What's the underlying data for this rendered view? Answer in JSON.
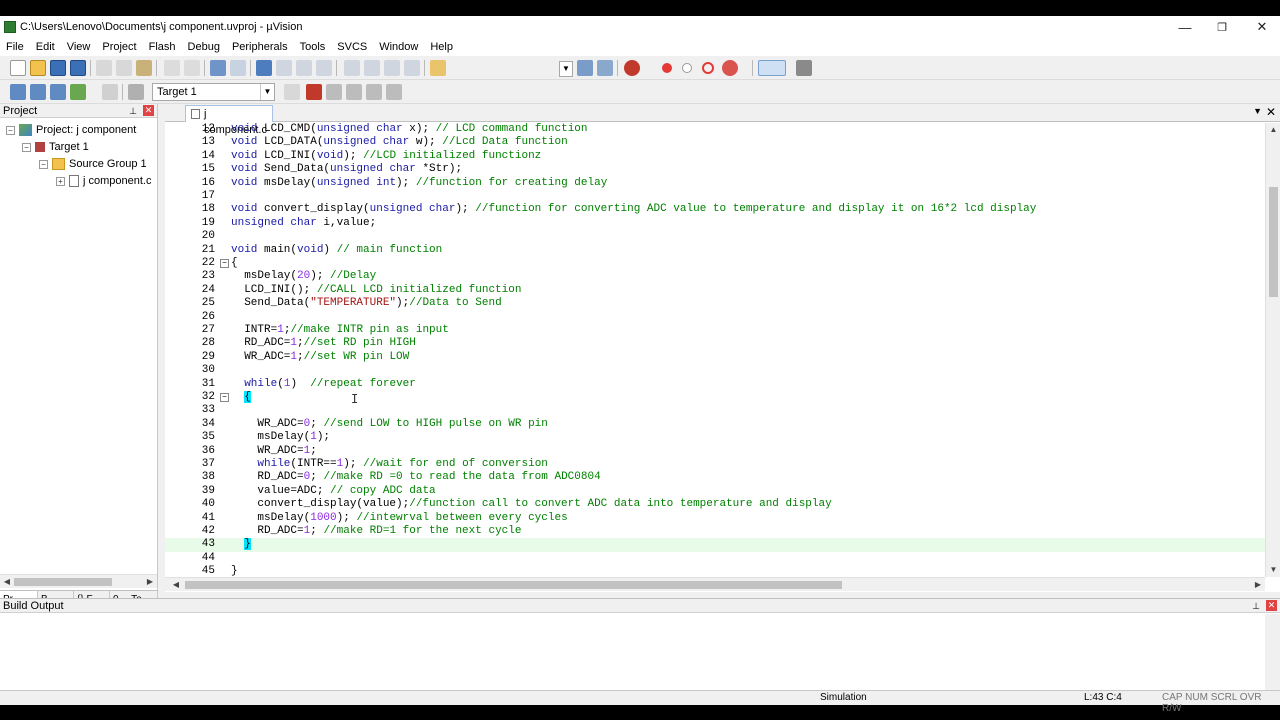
{
  "window": {
    "title": "C:\\Users\\Lenovo\\Documents\\j component.uvproj - µVision",
    "controls": [
      "—",
      "❐",
      "✕"
    ]
  },
  "menu": [
    "File",
    "Edit",
    "View",
    "Project",
    "Flash",
    "Debug",
    "Peripherals",
    "Tools",
    "SVCS",
    "Window",
    "Help"
  ],
  "toolbar2": {
    "target": "Target 1"
  },
  "project_panel": {
    "title": "Project",
    "tree": [
      {
        "label": "Project: j component",
        "indent": 0
      },
      {
        "label": "Target 1",
        "indent": 1
      },
      {
        "label": "Source Group 1",
        "indent": 2
      },
      {
        "label": "j component.c",
        "indent": 3
      }
    ],
    "tabs": [
      "Pr...",
      "B...",
      "{} F...",
      "0→ Te..."
    ]
  },
  "editor": {
    "tab": "j component.c",
    "lines": [
      {
        "n": "12",
        "html": "<span class=\"kw\">void</span> LCD_CMD(<span class=\"kw\">unsigned char</span> x); <span class=\"cm\">// LCD command function</span>"
      },
      {
        "n": "13",
        "html": "<span class=\"kw\">void</span> LCD_DATA(<span class=\"kw\">unsigned char</span> w); <span class=\"cm\">//Lcd Data function</span>"
      },
      {
        "n": "14",
        "html": "<span class=\"kw\">void</span> LCD_INI(<span class=\"kw\">void</span>); <span class=\"cm\">//LCD initialized functionz</span>"
      },
      {
        "n": "15",
        "html": "<span class=\"kw\">void</span> Send_Data(<span class=\"kw\">unsigned char</span> *Str);"
      },
      {
        "n": "16",
        "html": "<span class=\"kw\">void</span> msDelay(<span class=\"kw\">unsigned int</span>); <span class=\"cm\">//function for creating delay</span>"
      },
      {
        "n": "17",
        "html": ""
      },
      {
        "n": "18",
        "html": "<span class=\"kw\">void</span> convert_display(<span class=\"kw\">unsigned char</span>); <span class=\"cm\">//function for converting ADC value to temperature and display it on 16*2 lcd display</span>"
      },
      {
        "n": "19",
        "html": "<span class=\"kw\">unsigned char</span> i,value;"
      },
      {
        "n": "20",
        "html": ""
      },
      {
        "n": "21",
        "html": "<span class=\"kw\">void</span> main(<span class=\"kw\">void</span>) <span class=\"cm\">// main function</span>"
      },
      {
        "n": "22",
        "html": "{",
        "fold": "−"
      },
      {
        "n": "23",
        "html": "  msDelay(<span class=\"num\">20</span>); <span class=\"cm\">//Delay</span>"
      },
      {
        "n": "24",
        "html": "  LCD_INI(); <span class=\"cm\">//CALL LCD initialized function</span>"
      },
      {
        "n": "25",
        "html": "  Send_Data(<span class=\"str\">\"TEMPERATURE\"</span>);<span class=\"cm\">//Data to Send</span>"
      },
      {
        "n": "26",
        "html": ""
      },
      {
        "n": "27",
        "html": "  INTR=<span class=\"num\">1</span>;<span class=\"cm\">//make INTR pin as input</span>"
      },
      {
        "n": "28",
        "html": "  RD_ADC=<span class=\"num\">1</span>;<span class=\"cm\">//set RD pin HIGH</span>"
      },
      {
        "n": "29",
        "html": "  WR_ADC=<span class=\"num\">1</span>;<span class=\"cm\">//set WR pin LOW</span>"
      },
      {
        "n": "30",
        "html": ""
      },
      {
        "n": "31",
        "html": "  <span class=\"kw\">while</span>(<span class=\"num\">1</span>)  <span class=\"cm\">//repeat forever</span>"
      },
      {
        "n": "32",
        "html": "  <span class=\"brace-hl\">{</span>",
        "fold": "−"
      },
      {
        "n": "33",
        "html": ""
      },
      {
        "n": "34",
        "html": "    WR_ADC=<span class=\"num\">0</span>; <span class=\"cm\">//send LOW to HIGH pulse on WR pin</span>"
      },
      {
        "n": "35",
        "html": "    msDelay(<span class=\"num\">1</span>);"
      },
      {
        "n": "36",
        "html": "    WR_ADC=<span class=\"num\">1</span>;"
      },
      {
        "n": "37",
        "html": "    <span class=\"kw\">while</span>(INTR==<span class=\"num\">1</span>); <span class=\"cm\">//wait for end of conversion</span>"
      },
      {
        "n": "38",
        "html": "    RD_ADC=<span class=\"num\">0</span>; <span class=\"cm\">//make RD =0 to read the data from ADC0804</span>"
      },
      {
        "n": "39",
        "html": "    value=ADC; <span class=\"cm\">// copy ADC data</span>"
      },
      {
        "n": "40",
        "html": "    convert_display(value);<span class=\"cm\">//function call to convert ADC data into temperature and display</span>"
      },
      {
        "n": "41",
        "html": "    msDelay(<span class=\"num\">1000</span>); <span class=\"cm\">//intewrval between every cycles</span>"
      },
      {
        "n": "42",
        "html": "    RD_ADC=<span class=\"num\">1</span>; <span class=\"cm\">//make RD=1 for the next cycle</span>"
      },
      {
        "n": "43",
        "html": "  <span class=\"brace-hl\">}</span>",
        "current": true
      },
      {
        "n": "44",
        "html": ""
      },
      {
        "n": "45",
        "html": "}"
      }
    ]
  },
  "build_output": {
    "title": "Build Output"
  },
  "status": {
    "mode": "Simulation",
    "position": "L:43 C:4",
    "indicators": "CAP  NUM  SCRL  OVR  R/W"
  },
  "colors": {
    "keyword": "#1a1aa6",
    "comment": "#008000",
    "number": "#8a2be2",
    "brace_highlight": "#00e5ff"
  }
}
